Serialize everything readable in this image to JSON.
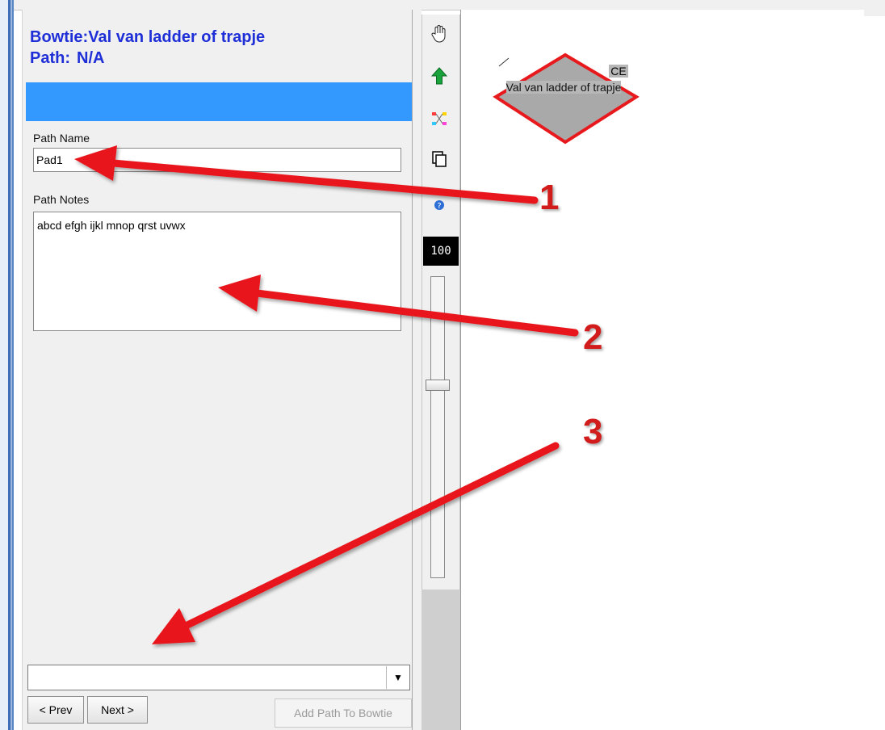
{
  "panel": {
    "bowtie_title": "Bowtie:Val van ladder of trapje",
    "path_label": "Path:",
    "path_value": "N/A",
    "path_name_label": "Path Name",
    "path_name_value": "Pad1",
    "path_notes_label": "Path Notes",
    "path_notes_value": "abcd efgh ijkl mnop qrst uvwx",
    "combo_value": "",
    "prev_label": "< Prev",
    "next_label": "Next >",
    "add_label": "Add Path To Bowtie"
  },
  "toolbar": {
    "tools": [
      "hand-icon",
      "arrow-up-icon",
      "connect-nodes-icon",
      "copy-icon",
      "help-icon"
    ],
    "zoom_value": "100",
    "zoom_level_fraction": 0.64
  },
  "canvas": {
    "node_tag": "CE",
    "node_label": "Val van ladder of trapje",
    "node_fill": "#a9a9a9",
    "node_border": "#e8191c"
  },
  "annotations": {
    "labels": [
      "1",
      "2",
      "3"
    ],
    "color": "#e8191c"
  },
  "colors": {
    "title_blue": "#1f2fd8",
    "bar_blue": "#3399ff"
  }
}
